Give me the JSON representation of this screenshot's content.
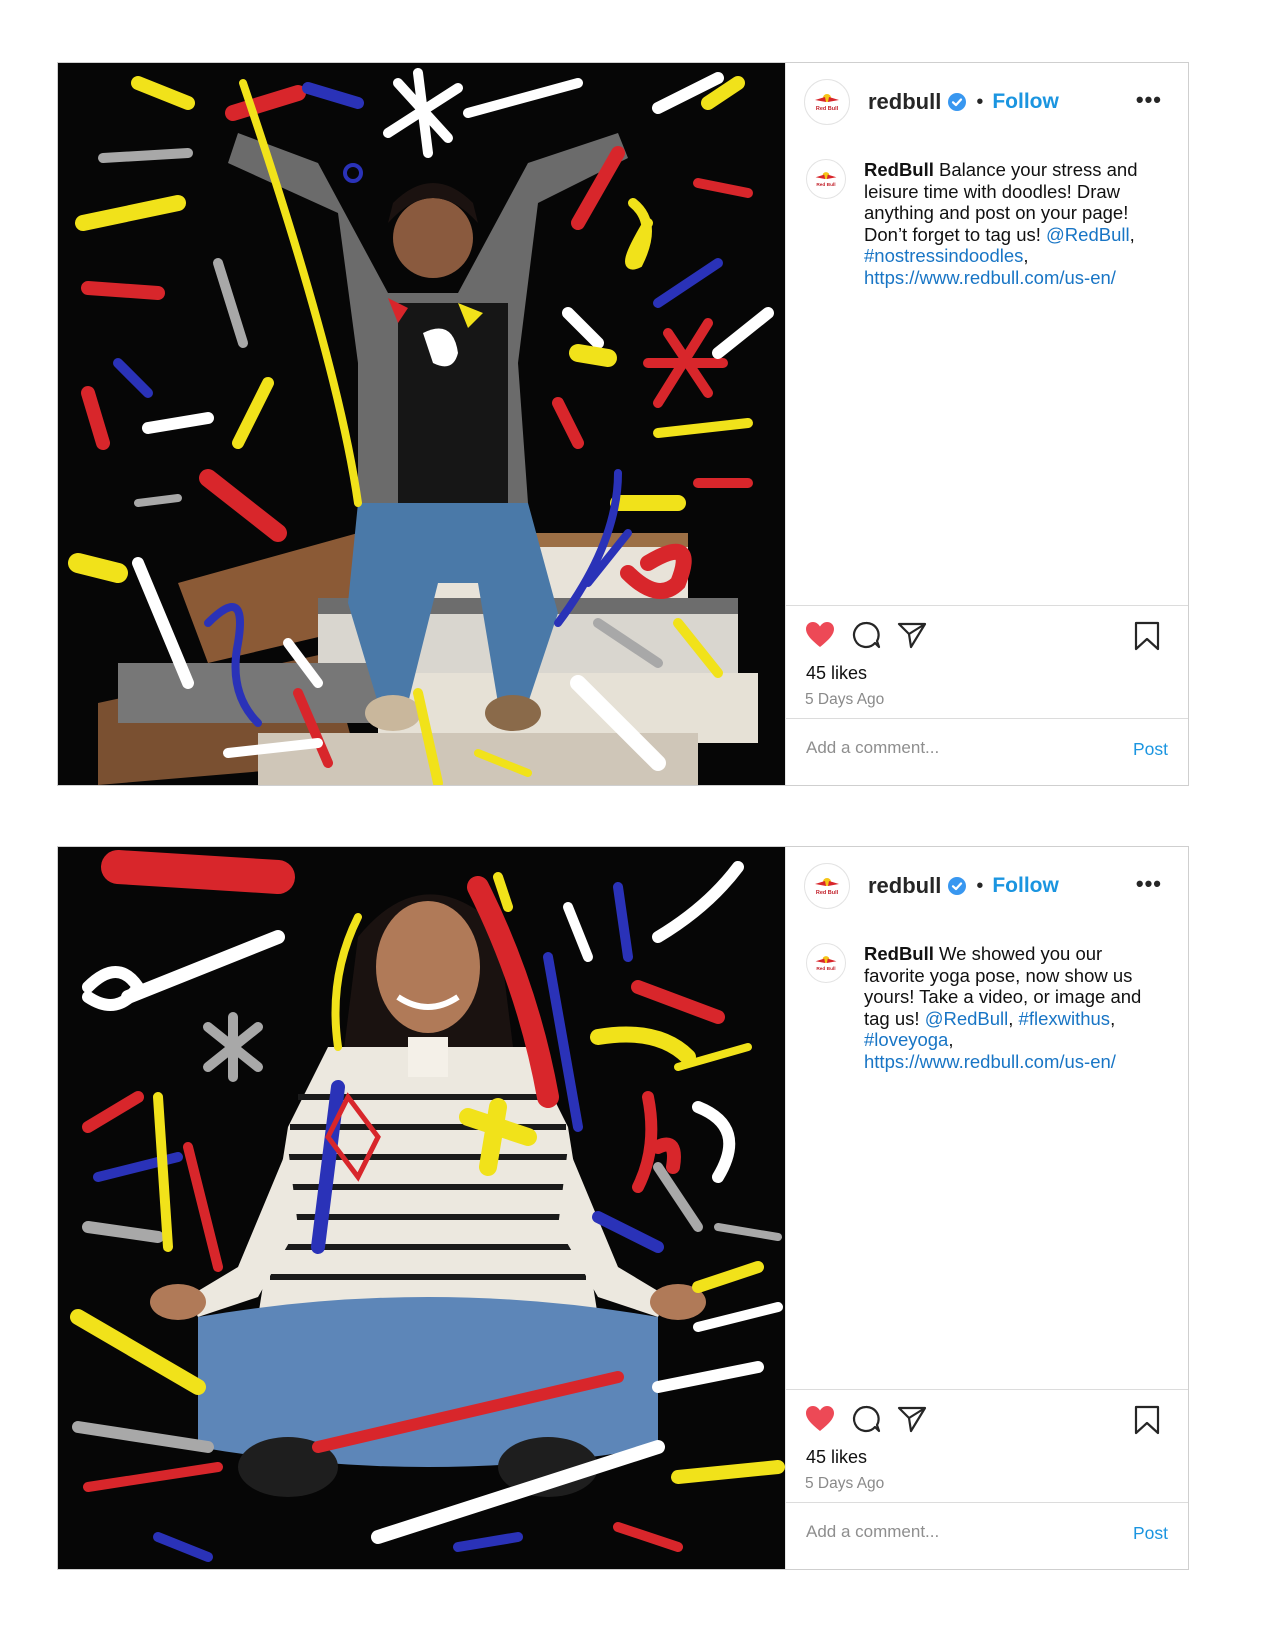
{
  "colors": {
    "accent": "#1b95e0",
    "heart": "#ed4956",
    "verified": "#3897f0"
  },
  "posts": [
    {
      "username": "redbull",
      "follow_label": "Follow",
      "more_label": "•••",
      "avatar_text": "Red Bull",
      "caption_author": "RedBull",
      "caption_text": "Balance your stress and leisure time with doodles! Draw anything and post on your page! Don’t forget to tag us!",
      "mention": "@RedBull",
      "sep1": ",",
      "hashtag1": "#nostressindoodles",
      "sep2": ",",
      "hashtag2": "",
      "sep3": "",
      "url": "https://www.redbull.com/us-en/",
      "likes": "45 likes",
      "time": "5 Days Ago",
      "comment_placeholder": "Add a comment...",
      "post_label": "Post",
      "icons": [
        "heart-icon",
        "comment-icon",
        "share-icon",
        "bookmark-icon"
      ]
    },
    {
      "username": "redbull",
      "follow_label": "Follow",
      "more_label": "•••",
      "avatar_text": "Red Bull",
      "caption_author": "RedBull",
      "caption_text": "We showed you our favorite yoga pose, now show us yours! Take a video, or image and tag us!",
      "mention": "@RedBull",
      "sep1": ",",
      "hashtag1": "#flexwithus",
      "sep2": ",",
      "hashtag2": "#loveyoga",
      "sep3": ",",
      "url": "https://www.redbull.com/us-en/",
      "likes": "45 likes",
      "time": "5 Days Ago",
      "comment_placeholder": "Add a comment...",
      "post_label": "Post",
      "icons": [
        "heart-icon",
        "comment-icon",
        "share-icon",
        "bookmark-icon"
      ]
    }
  ]
}
